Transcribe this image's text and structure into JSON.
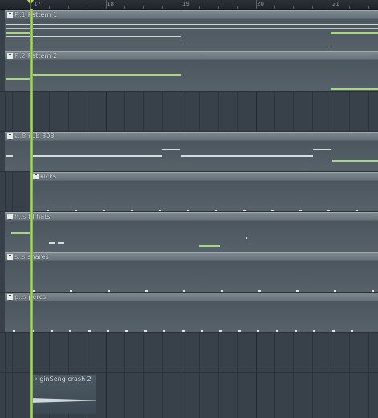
{
  "ruler": {
    "bars": [
      "17",
      "18",
      "19",
      "20",
      "21"
    ]
  },
  "tracks": [
    {
      "short": "P..1",
      "name": "Pattern 1"
    },
    {
      "short": "P..2",
      "name": "Pattern 2"
    },
    {
      "short": "s..8",
      "name": "sub 808"
    },
    {
      "short": "",
      "name": "kicks"
    },
    {
      "short": "h..s",
      "name": "hi hats"
    },
    {
      "short": "s..s",
      "name": "snares"
    },
    {
      "short": "p..s",
      "name": "percs"
    }
  ],
  "audio_clip": {
    "name": "ginSeng crash 2"
  },
  "colors": {
    "playhead": "#b6e15f",
    "note": "#a8d878",
    "clip_body": "#56616a",
    "background": "#38414a"
  }
}
